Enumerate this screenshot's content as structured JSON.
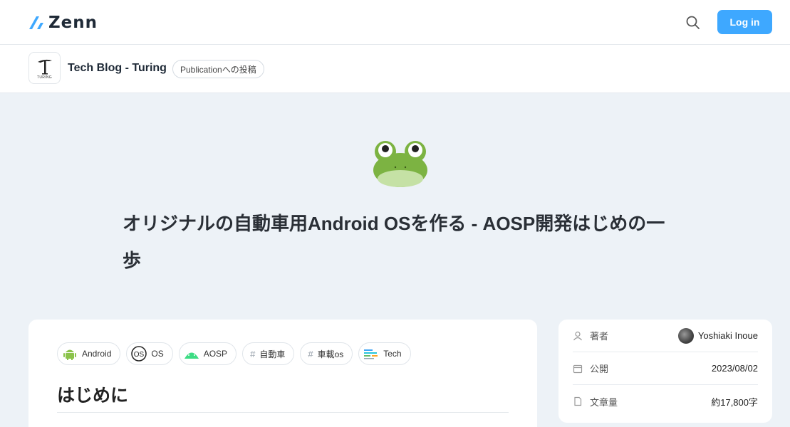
{
  "header": {
    "logo_text": "Zenn",
    "login_label": "Log in"
  },
  "publication": {
    "logo_caption": "TURING",
    "name": "Tech Blog - Turing",
    "badge": "Publicationへの投稿"
  },
  "article": {
    "title": "オリジナルの自動車用Android OSを作る - AOSP開発はじめの一歩",
    "tags": [
      {
        "label": "Android",
        "icon": "android-icon"
      },
      {
        "label": "OS",
        "icon": "os-icon"
      },
      {
        "label": "AOSP",
        "icon": "aosp-icon"
      },
      {
        "label": "自動車",
        "icon": "hash-icon"
      },
      {
        "label": "車載os",
        "icon": "hash-icon"
      },
      {
        "label": "Tech",
        "icon": "tech-icon"
      }
    ],
    "first_heading": "はじめに"
  },
  "sidebar": {
    "author_label": "著者",
    "author_name": "Yoshiaki Inoue",
    "published_label": "公開",
    "published_date": "2023/08/02",
    "length_label": "文章量",
    "length_value": "約17,800字"
  },
  "colors": {
    "accent": "#3ea8ff",
    "background": "#edf2f7"
  }
}
